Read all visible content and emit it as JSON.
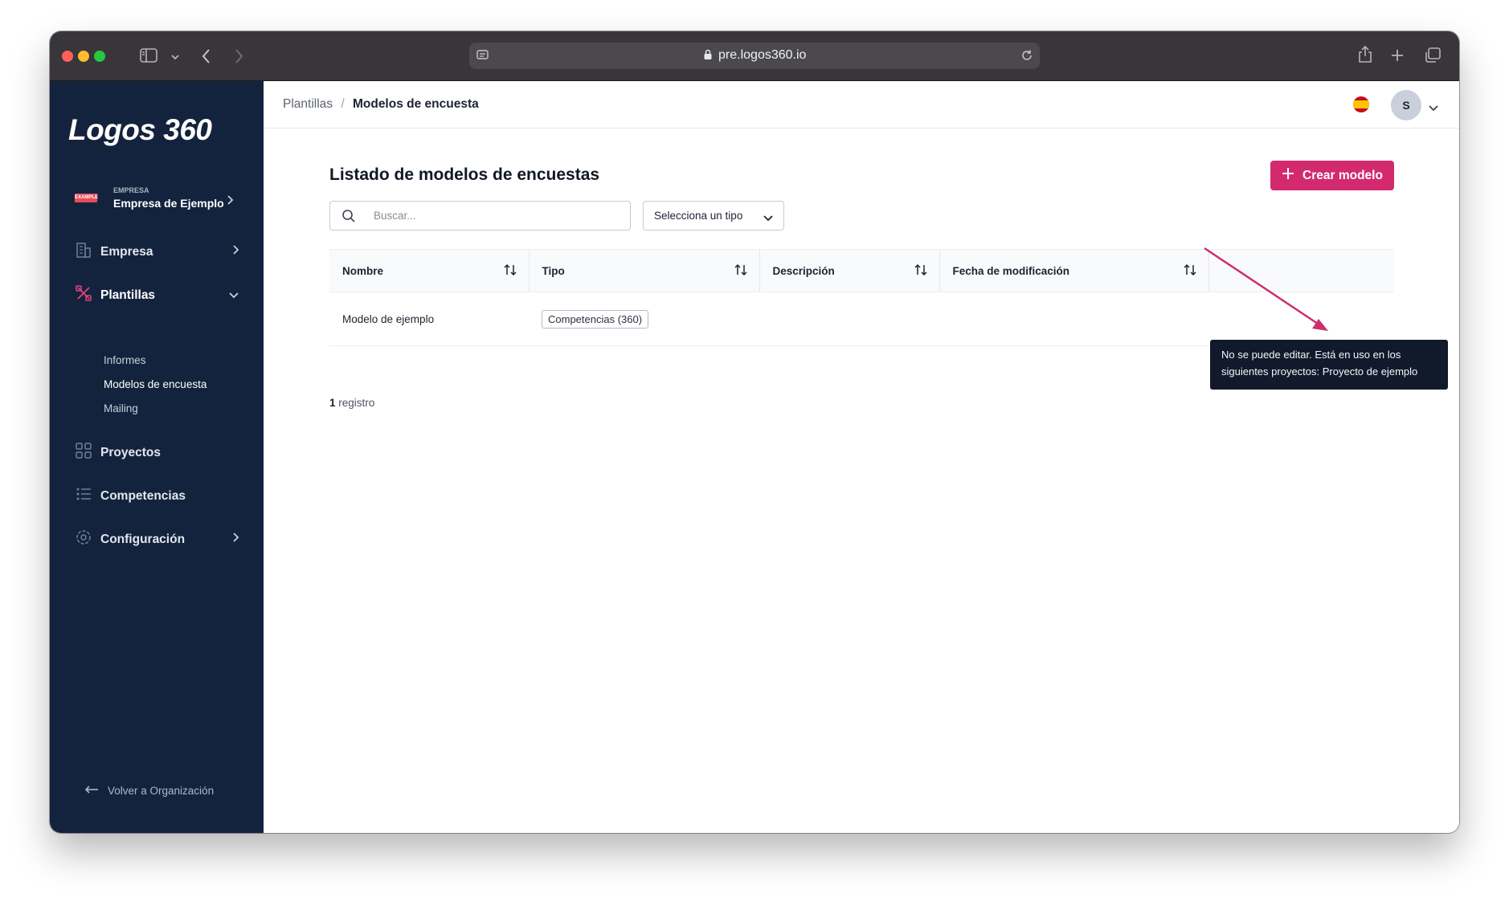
{
  "browser": {
    "url": "pre.logos360.io"
  },
  "sidebar": {
    "logo": "Logos 360",
    "company": {
      "caption": "EMPRESA",
      "name": "Empresa de Ejemplo",
      "logo_text": "EXAMPLE"
    },
    "items": [
      {
        "label": "Empresa",
        "icon": "building-icon"
      },
      {
        "label": "Plantillas",
        "icon": "templates-icon"
      },
      {
        "label": "Proyectos",
        "icon": "grid-icon"
      },
      {
        "label": "Competencias",
        "icon": "list-icon"
      },
      {
        "label": "Configuración",
        "icon": "gear-icon"
      }
    ],
    "subitems": [
      "Informes",
      "Modelos de encuesta",
      "Mailing"
    ],
    "back_label": "Volver a Organización"
  },
  "topbar": {
    "breadcrumb_parent": "Plantillas",
    "breadcrumb_separator": "/",
    "breadcrumb_current": "Modelos de encuesta",
    "avatar_initial": "S",
    "language_flag": "spain-flag-icon"
  },
  "page": {
    "title": "Listado de modelos de encuestas",
    "create_button": "Crear modelo",
    "search_placeholder": "Buscar...",
    "type_select": "Selecciona un tipo"
  },
  "table": {
    "columns": [
      "Nombre",
      "Tipo",
      "Descripción",
      "Fecha de modificación"
    ],
    "rows": [
      {
        "name": "Modelo de ejemplo",
        "type": "Competencias (360)",
        "description": "",
        "modified": ""
      }
    ]
  },
  "footer": {
    "count": "1",
    "count_label": "registro"
  },
  "tooltip": {
    "line1": "No se puede editar. Está en uso en los",
    "line2": "siguientes proyectos: Proyecto de ejemplo"
  },
  "colors": {
    "accent": "#d32a6f",
    "sidebar": "#14233d",
    "arrow": "#cc2f6f"
  }
}
